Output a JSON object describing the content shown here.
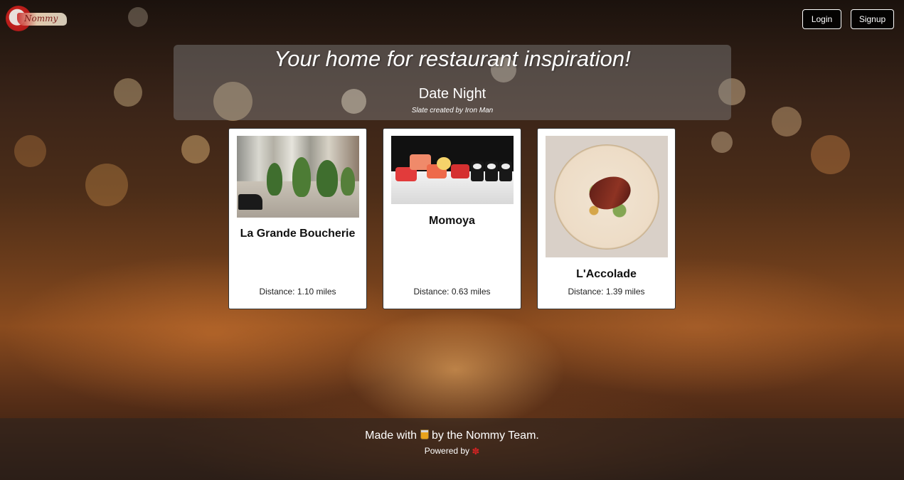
{
  "header": {
    "logo_text": "Nommy",
    "login_label": "Login",
    "signup_label": "Signup"
  },
  "hero": {
    "title": "Your home for restaurant inspiration!",
    "slate_name": "Date Night",
    "slate_creator": "Slate created by Iron Man"
  },
  "restaurants": [
    {
      "name": "La Grande Boucherie",
      "distance": "Distance: 1.10 miles"
    },
    {
      "name": "Momoya",
      "distance": "Distance: 0.63 miles"
    },
    {
      "name": "L'Accolade",
      "distance": "Distance: 1.39 miles"
    }
  ],
  "footer": {
    "made_prefix": "Made with",
    "made_suffix": "by the Nommy Team.",
    "powered_by": "Powered by",
    "made_icon": "drink-icon",
    "powered_icon": "yelp-icon"
  },
  "colors": {
    "button_border": "#ffffff",
    "card_background": "#ffffff",
    "yelp_red": "#d32323"
  }
}
